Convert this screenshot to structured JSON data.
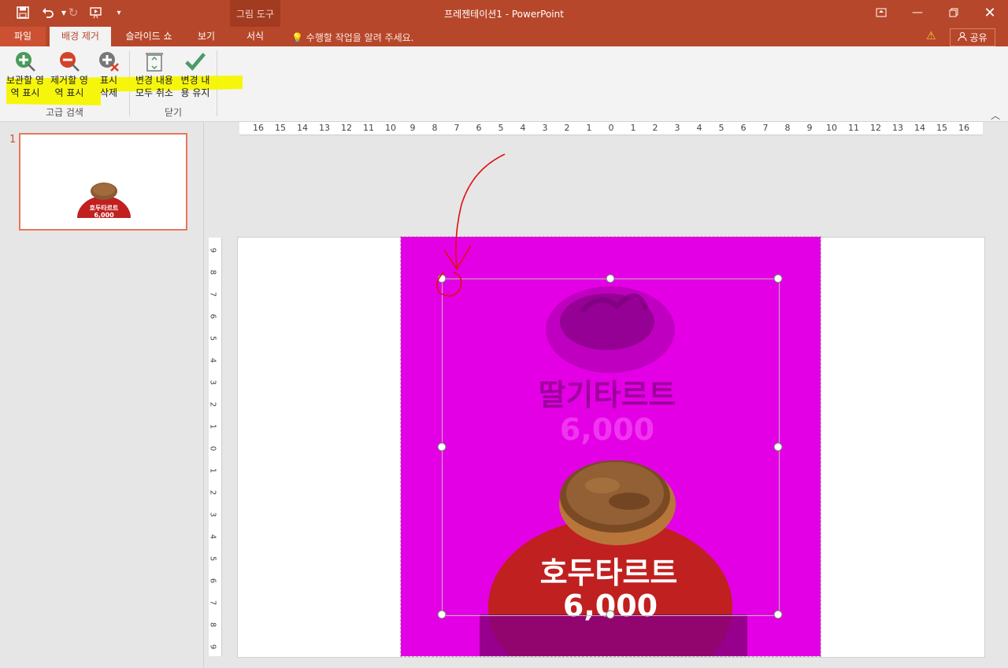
{
  "window": {
    "title": "프레젠테이션1 - PowerPoint",
    "context_group": "그림 도구"
  },
  "tabs": [
    {
      "label": "파일"
    },
    {
      "label": "배경 제거"
    },
    {
      "label": "슬라이드 쇼"
    },
    {
      "label": "보기"
    },
    {
      "label": "서식"
    }
  ],
  "tellme": "수행할 작업을 알려 주세요.",
  "share_label": "공유",
  "ribbon": {
    "buttons": [
      {
        "label": "보관할 영\n역 표시",
        "icon": "plus-mark-icon"
      },
      {
        "label": "제거할 영\n역 표시",
        "icon": "minus-mark-icon"
      },
      {
        "label": "표시\n삭제",
        "icon": "delete-mark-icon"
      },
      {
        "label": "변경 내용\n모두 취소",
        "icon": "recycle-bin-icon"
      },
      {
        "label": "변경 내\n용 유지",
        "icon": "checkmark-icon"
      }
    ],
    "groups": [
      "고급 검색",
      "닫기"
    ]
  },
  "slides": {
    "number": "1"
  },
  "ruler": {
    "h_ticks": [
      "16",
      "15",
      "14",
      "13",
      "12",
      "11",
      "10",
      "9",
      "8",
      "7",
      "6",
      "5",
      "4",
      "3",
      "2",
      "1",
      "0",
      "1",
      "2",
      "3",
      "4",
      "5",
      "6",
      "7",
      "8",
      "9",
      "10",
      "11",
      "12",
      "13",
      "14",
      "15",
      "16"
    ],
    "v_ticks": [
      "9",
      "8",
      "7",
      "6",
      "5",
      "4",
      "3",
      "2",
      "1",
      "0",
      "1",
      "2",
      "3",
      "4",
      "5",
      "6",
      "7",
      "8",
      "9"
    ]
  },
  "slide_content": {
    "top_product": "딸기타르트",
    "top_price": "6,000",
    "bottom_product": "호두타르트",
    "bottom_price": "6,000"
  },
  "colors": {
    "accent": "#b7472a",
    "removal_overlay": "#e400e4",
    "circle_red": "#c0201f"
  }
}
